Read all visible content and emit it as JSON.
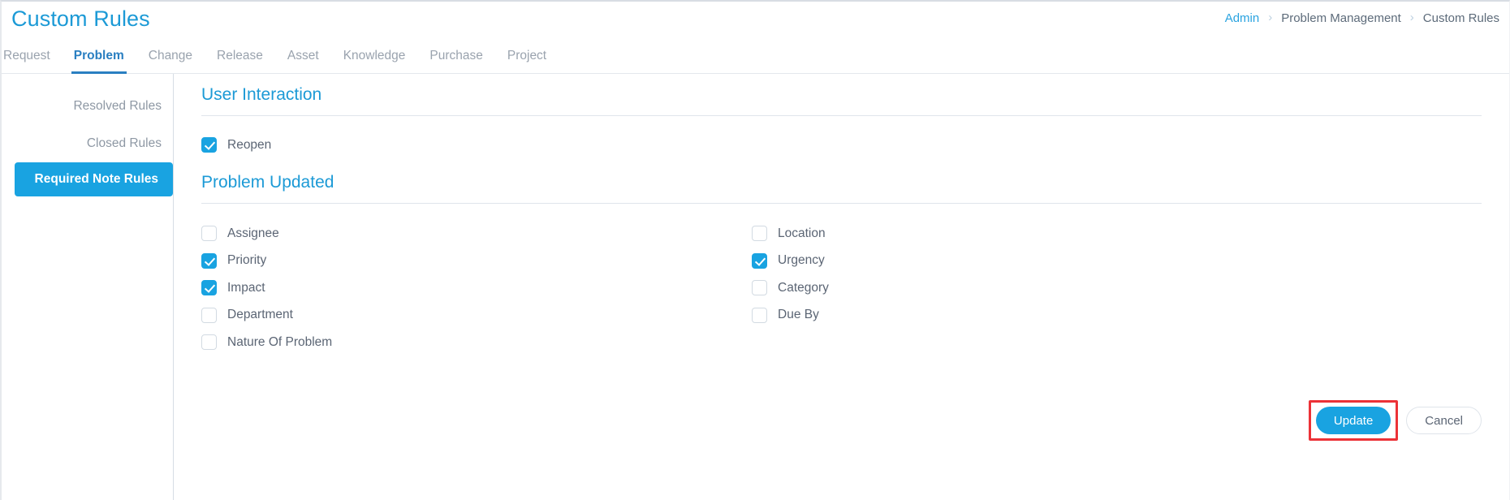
{
  "header": {
    "title": "Custom Rules",
    "breadcrumb": [
      {
        "label": "Admin",
        "type": "link"
      },
      {
        "label": "Problem Management",
        "type": "plain"
      },
      {
        "label": "Custom Rules",
        "type": "plain"
      }
    ],
    "separator_icon": "chevron-right-icon"
  },
  "tabs": [
    {
      "label": "Request",
      "active": false
    },
    {
      "label": "Problem",
      "active": true
    },
    {
      "label": "Change",
      "active": false
    },
    {
      "label": "Release",
      "active": false
    },
    {
      "label": "Asset",
      "active": false
    },
    {
      "label": "Knowledge",
      "active": false
    },
    {
      "label": "Purchase",
      "active": false
    },
    {
      "label": "Project",
      "active": false
    }
  ],
  "sidebar": {
    "items": [
      {
        "label": "Resolved Rules",
        "active": false
      },
      {
        "label": "Closed Rules",
        "active": false
      },
      {
        "label": "Required Note Rules",
        "active": true
      }
    ]
  },
  "sections": {
    "user_interaction": {
      "title": "User Interaction",
      "options": [
        {
          "label": "Reopen",
          "checked": true
        }
      ]
    },
    "problem_updated": {
      "title": "Problem Updated",
      "left_options": [
        {
          "label": "Assignee",
          "checked": false
        },
        {
          "label": "Priority",
          "checked": true
        },
        {
          "label": "Impact",
          "checked": true
        },
        {
          "label": "Department",
          "checked": false
        },
        {
          "label": "Nature Of Problem",
          "checked": false
        }
      ],
      "right_options": [
        {
          "label": "Location",
          "checked": false
        },
        {
          "label": "Urgency",
          "checked": true
        },
        {
          "label": "Category",
          "checked": false
        },
        {
          "label": "Due By",
          "checked": false
        }
      ]
    }
  },
  "footer": {
    "update_label": "Update",
    "cancel_label": "Cancel",
    "highlight_color": "#ec3237"
  },
  "colors": {
    "accent": "#19a3e1",
    "title": "#1c9ad6",
    "active_tab": "#2a7fc1",
    "muted_text": "#8e98a4",
    "label_text": "#5b6574"
  }
}
